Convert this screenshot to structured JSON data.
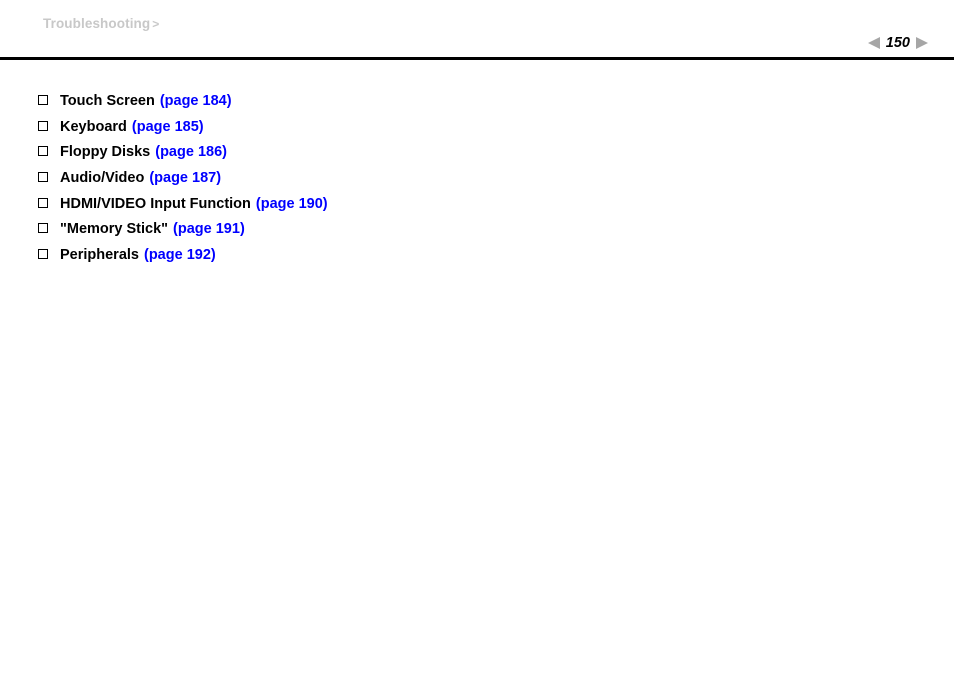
{
  "header": {
    "breadcrumb_label": "Troubleshooting",
    "breadcrumb_separator": ">",
    "page_number": "150",
    "prev_icon": "triangle-left-icon",
    "next_icon": "triangle-right-icon",
    "rule_color": "#000000",
    "breadcrumb_color": "#c8c8c8",
    "arrow_color": "#a6a6a6"
  },
  "colors": {
    "link": "#0000ff",
    "text": "#000000",
    "background": "#ffffff"
  },
  "content": {
    "bullet_icon": "hollow-square-icon",
    "items": [
      {
        "label": "Touch Screen",
        "link": "(page 184)"
      },
      {
        "label": "Keyboard",
        "link": "(page 185)"
      },
      {
        "label": "Floppy Disks",
        "link": "(page 186)"
      },
      {
        "label": "Audio/Video",
        "link": "(page 187)"
      },
      {
        "label": "HDMI/VIDEO Input Function",
        "link": "(page 190)"
      },
      {
        "label": "\"Memory Stick\"",
        "link": "(page 191)"
      },
      {
        "label": "Peripherals",
        "link": "(page 192)"
      }
    ]
  }
}
